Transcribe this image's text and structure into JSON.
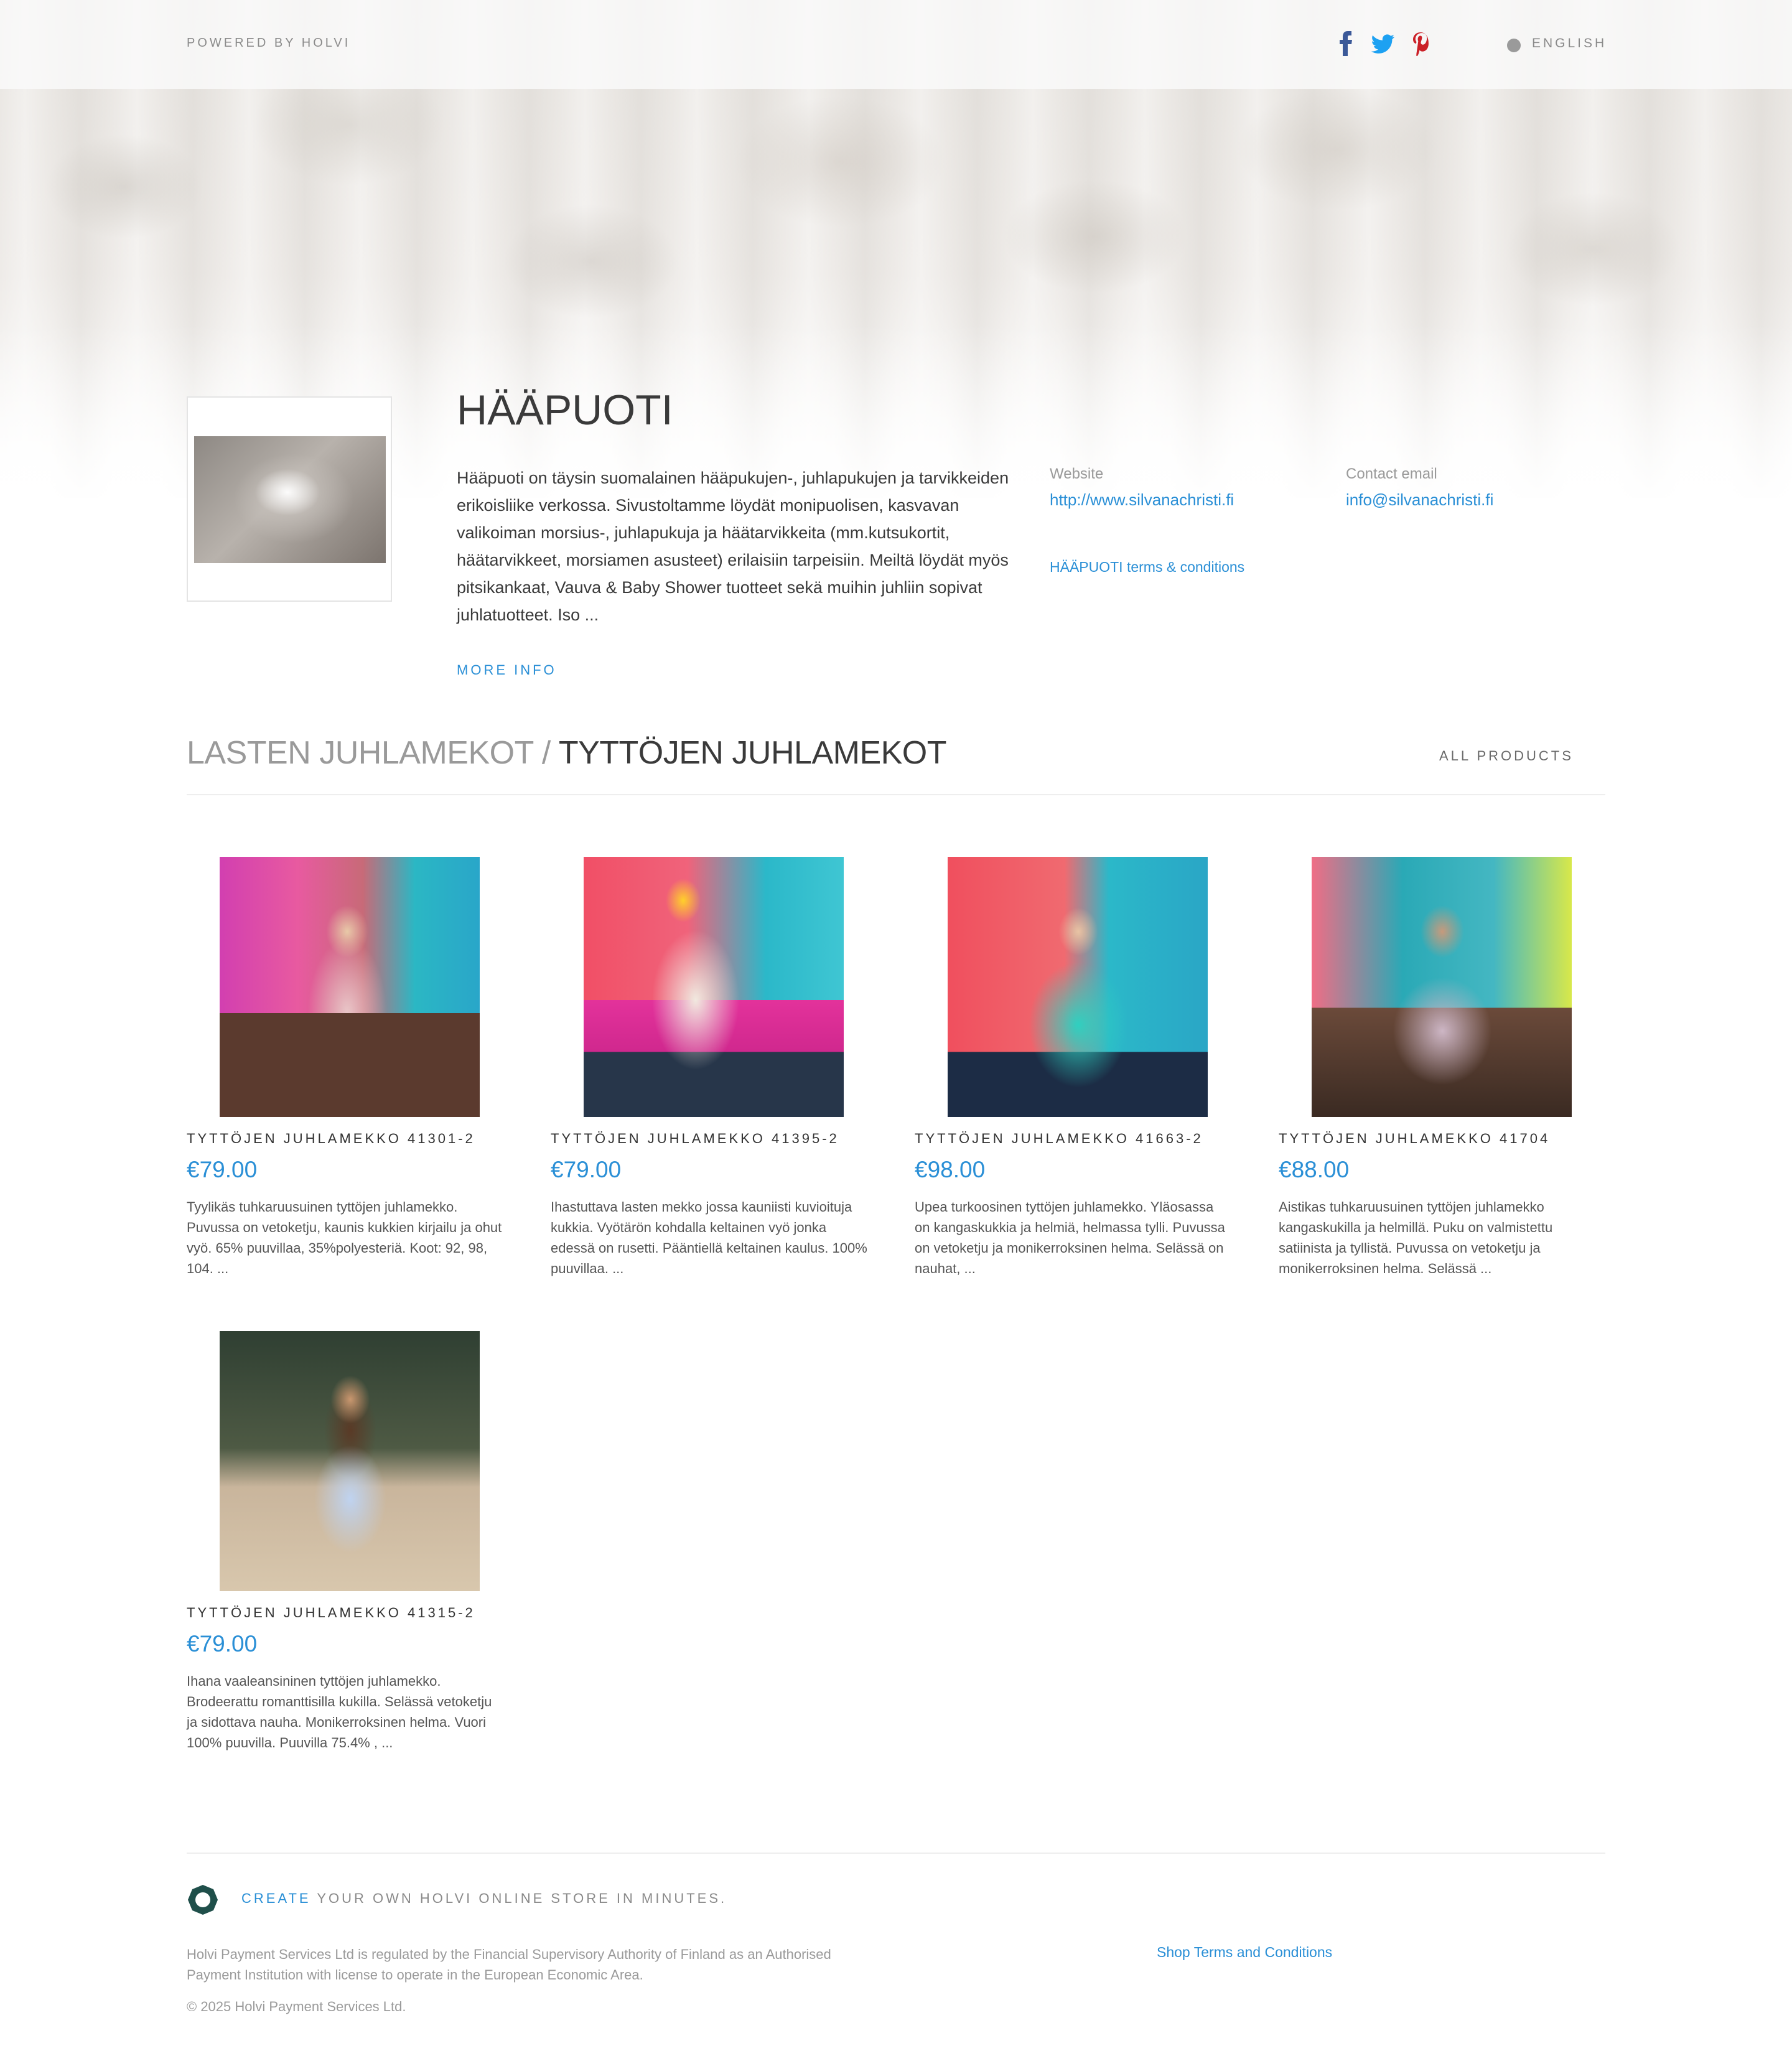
{
  "topbar": {
    "powered_by": "POWERED BY HOLVI",
    "language": "ENGLISH",
    "social_icons": [
      "facebook-icon",
      "twitter-icon",
      "pinterest-icon"
    ]
  },
  "store": {
    "title": "HÄÄPUOTI",
    "description": "Hääpuoti on täysin suomalainen hääpukujen-, juhlapukujen ja tarvikkeiden erikoisliike verkossa. Sivustoltamme löydät monipuolisen, kasvavan valikoiman morsius-, juhlapukuja ja häätarvikkeita (mm.kutsukortit, häätarvikkeet, morsiamen asusteet) erilaisiin tarpeisiin. Meiltä löydät myös pitsikankaat, Vauva & Baby Shower tuotteet sekä muihin juhliin sopivat juhlatuotteet. Iso ...",
    "more_info": "MORE INFO",
    "website_label": "Website",
    "website": "http://www.silvanachristi.fi",
    "email_label": "Contact email",
    "email": "info@silvanachristi.fi",
    "terms": "HÄÄPUOTI terms & conditions"
  },
  "breadcrumb": {
    "category": "LASTEN JUHLAMEKOT",
    "separator": " / ",
    "subcategory": "TYTTÖJEN JUHLAMEKOT",
    "all_products": "ALL PRODUCTS"
  },
  "products": [
    {
      "name": "TYTTÖJEN JUHLAMEKKO 41301-2",
      "price": "€79.00",
      "description": "Tyylikäs tuhkaruusuinen tyttöjen juhlamekko. Puvussa on vetoketju, kaunis kukkien kirjailu ja ohut vyö. 65% puuvillaa, 35%polyesteriä. Koot: 92, 98, 104. ..."
    },
    {
      "name": "TYTTÖJEN JUHLAMEKKO 41395-2",
      "price": "€79.00",
      "description": "Ihastuttava lasten mekko jossa kauniisti kuvioituja kukkia. Vyötärön kohdalla keltainen vyö jonka edessä on rusetti. Pääntiellä keltainen kaulus. 100% puuvillaa. ..."
    },
    {
      "name": "TYTTÖJEN JUHLAMEKKO 41663-2",
      "price": "€98.00",
      "description": "Upea turkoosinen tyttöjen juhlamekko. Yläosassa on kangaskukkia ja helmiä, helmassa tylli. Puvussa on vetoketju ja monikerroksinen helma. Selässä on nauhat, ..."
    },
    {
      "name": "TYTTÖJEN JUHLAMEKKO 41704",
      "price": "€88.00",
      "description": "Aistikas tuhkaruusuinen tyttöjen juhlamekko kangaskukilla ja helmillä. Puku on valmistettu satiinista ja tyllistä. Puvussa on vetoketju ja monikerroksinen helma. Selässä ..."
    },
    {
      "name": "TYTTÖJEN JUHLAMEKKO 41315-2",
      "price": "€79.00",
      "description": "Ihana vaaleansininen tyttöjen juhlamekko. Brodeerattu romanttisilla kukilla. Selässä vetoketju ja sidottava nauha. Monikerroksinen helma. Vuori 100% puuvilla. Puuvilla 75.4% , ..."
    }
  ],
  "footer": {
    "create_link": "CREATE",
    "create_rest": " YOUR OWN HOLVI ONLINE STORE IN MINUTES.",
    "legal": "Holvi Payment Services Ltd is regulated by the Financial Supervisory Authority of Finland as an Authorised Payment Institution with license to operate in the European Economic Area.",
    "shop_terms": "Shop Terms and Conditions",
    "copyright": "© 2025 Holvi Payment Services Ltd."
  },
  "colors": {
    "accent": "#2a8fd6",
    "facebook": "#3b5998",
    "twitter": "#1da1f2",
    "pinterest": "#cb2027",
    "holvi_logo": "#1f4f4a"
  }
}
